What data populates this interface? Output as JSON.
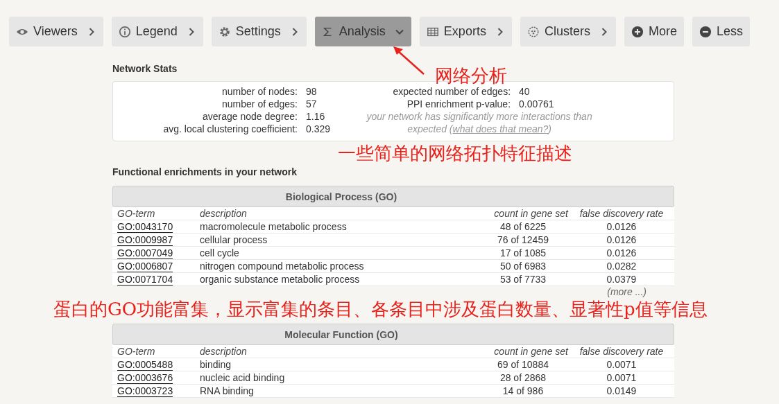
{
  "toolbar": [
    {
      "label": "Viewers",
      "kind": "menu",
      "expanded": false
    },
    {
      "label": "Legend",
      "kind": "menu",
      "expanded": false
    },
    {
      "label": "Settings",
      "kind": "menu",
      "expanded": false
    },
    {
      "label": "Analysis",
      "kind": "menu",
      "expanded": true
    },
    {
      "label": "Exports",
      "kind": "menu",
      "expanded": false
    },
    {
      "label": "Clusters",
      "kind": "menu",
      "expanded": false
    },
    {
      "label": "More",
      "kind": "action"
    },
    {
      "label": "Less",
      "kind": "action"
    }
  ],
  "annotations": [
    {
      "text": "网络分析"
    },
    {
      "text": "一些简单的网络拓扑特征描述"
    },
    {
      "text": "蛋白的GO功能富集，显示富集的条目、各条目中涉及蛋白数量、显著性p值等信息"
    }
  ],
  "network_stats": {
    "title": "Network Stats",
    "left": [
      {
        "label": "number of nodes:",
        "value": "98"
      },
      {
        "label": "number of edges:",
        "value": "57"
      },
      {
        "label": "average node degree:",
        "value": "1.16"
      },
      {
        "label": "avg. local clustering coefficient:",
        "value": "0.329"
      }
    ],
    "right": [
      {
        "label": "expected number of edges:",
        "value": "40"
      },
      {
        "label": "PPI enrichment p-value:",
        "value": "0.00761"
      }
    ],
    "note": "your network has significantly more interactions than expected (",
    "note_link": "what does that mean?",
    "note_end": ")"
  },
  "enrichment": {
    "title": "Functional enrichments in your network",
    "tables": [
      {
        "title": "Biological Process (GO)",
        "columns": [
          "GO-term",
          "description",
          "count in gene set",
          "false discovery rate"
        ],
        "more": "(more ...)",
        "rows": [
          [
            "GO:0043170",
            "macromolecule metabolic process",
            "48 of 6225",
            "0.0126"
          ],
          [
            "GO:0009987",
            "cellular process",
            "76 of 12459",
            "0.0126"
          ],
          [
            "GO:0007049",
            "cell cycle",
            "17 of 1085",
            "0.0126"
          ],
          [
            "GO:0006807",
            "nitrogen compound metabolic process",
            "50 of 6983",
            "0.0282"
          ],
          [
            "GO:0071704",
            "organic substance metabolic process",
            "53 of 7733",
            "0.0379"
          ]
        ]
      },
      {
        "title": "Molecular Function (GO)",
        "columns": [
          "GO-term",
          "description",
          "count in gene set",
          "false discovery rate"
        ],
        "rows": [
          [
            "GO:0005488",
            "binding",
            "69 of 10884",
            "0.0071"
          ],
          [
            "GO:0003676",
            "nucleic acid binding",
            "28 of 2868",
            "0.0071"
          ],
          [
            "GO:0003723",
            "RNA binding",
            "14 of 986",
            "0.0149"
          ]
        ]
      }
    ]
  }
}
